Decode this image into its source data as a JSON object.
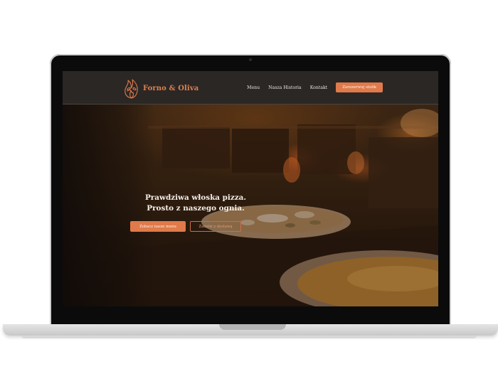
{
  "brand": {
    "name": "Forno & Oliva",
    "accent_color": "#e07a4a",
    "logo_icon": "flame-olive-icon"
  },
  "nav": {
    "items": [
      {
        "label": "Menu"
      },
      {
        "label": "Nasza Historia"
      },
      {
        "label": "Kontakt"
      }
    ],
    "cta_label": "Zarezerwuj stolik"
  },
  "hero": {
    "title_line1": "Prawdziwa włoska pizza.",
    "title_line2": "Prosto z naszego ognia.",
    "primary_cta": "Zobacz nasze menu",
    "secondary_cta": "Zamów z dostawą",
    "background_image": "pizza-oven-photo"
  }
}
